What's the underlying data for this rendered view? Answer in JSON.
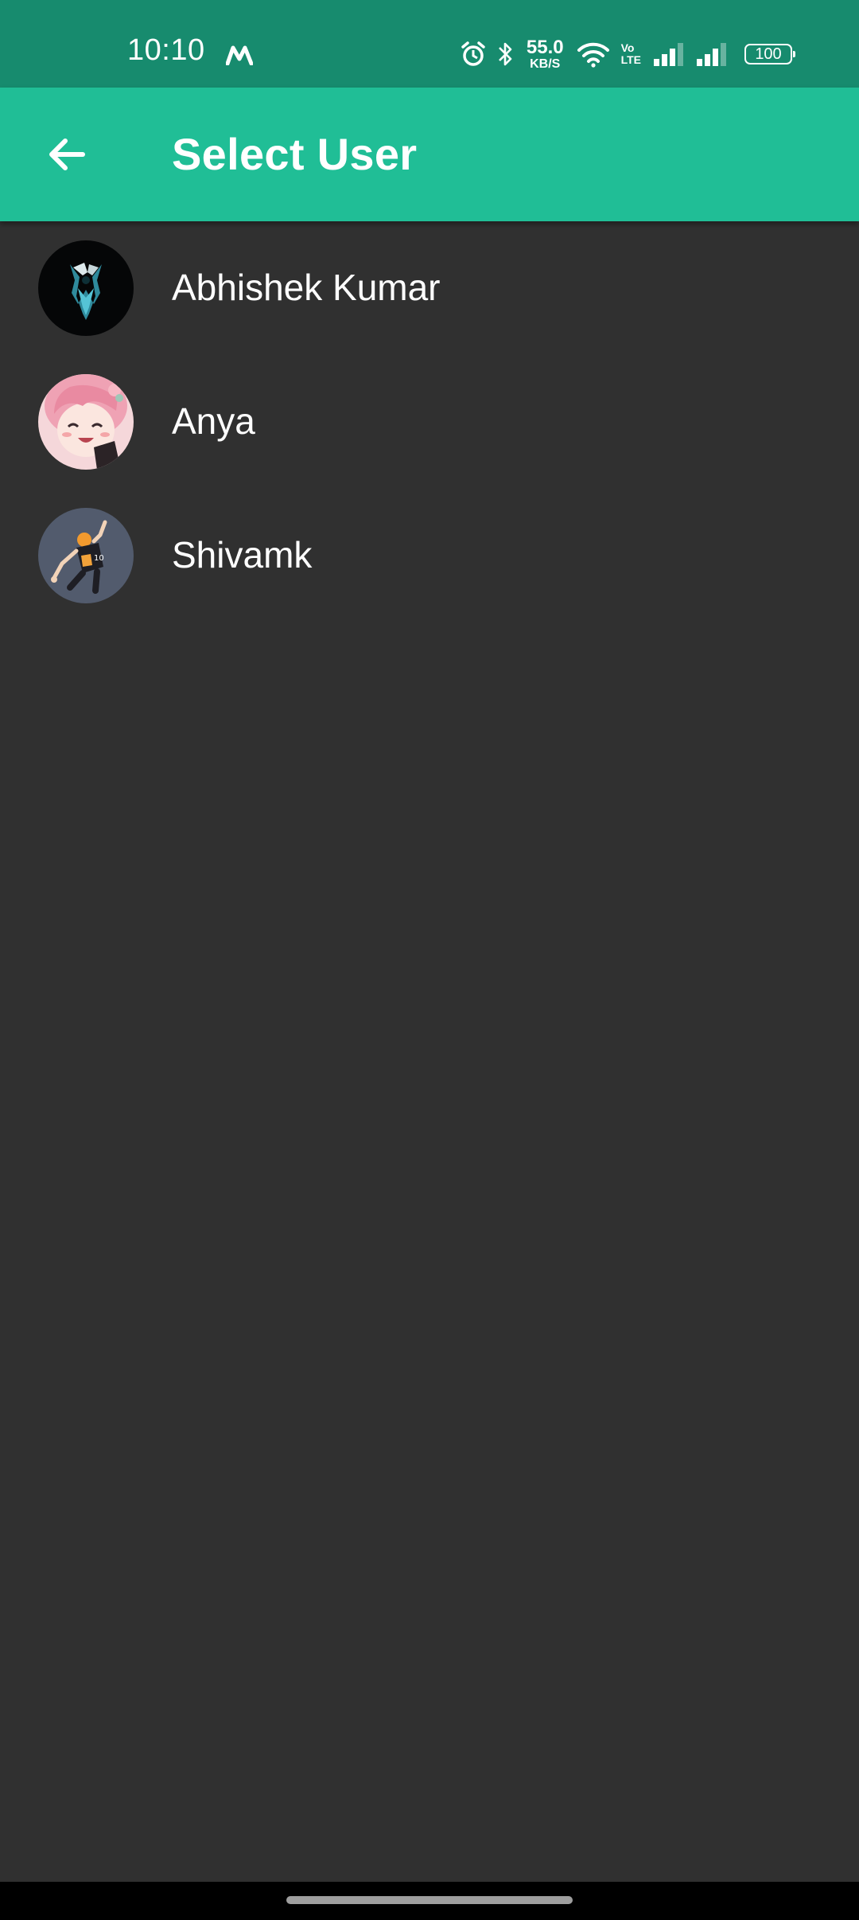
{
  "status_bar": {
    "time": "10:10",
    "net_speed_value": "55.0",
    "net_speed_unit": "KB/S",
    "volte_line1": "Vo",
    "volte_line2": "LTE",
    "battery": "100",
    "background_color": "#178B6E"
  },
  "app_bar": {
    "title": "Select User",
    "back_icon": "arrow-back-icon",
    "background_color": "#20BE96"
  },
  "users": [
    {
      "name": "Abhishek Kumar",
      "avatar": "skyrim-emblem-avatar"
    },
    {
      "name": "Anya",
      "avatar": "pink-hair-anime-girl-avatar"
    },
    {
      "name": "Shivamk",
      "avatar": "volleyball-player-avatar"
    }
  ],
  "colors": {
    "background": "#303030",
    "text": "#FFFFFF"
  }
}
